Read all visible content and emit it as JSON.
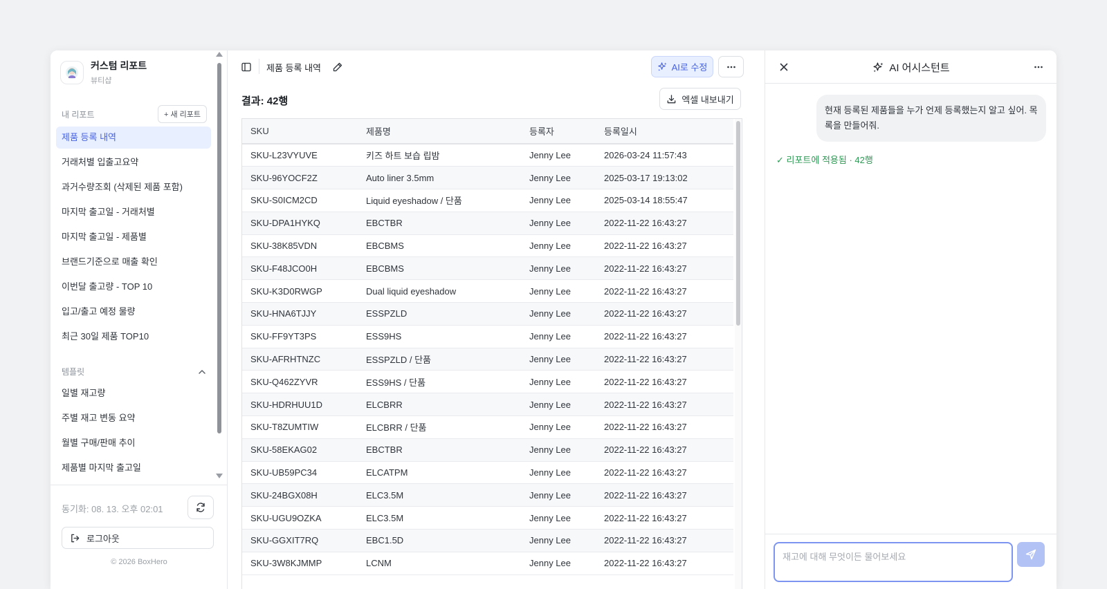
{
  "sidebar": {
    "brand_title": "커스텀 리포트",
    "brand_subtitle": "뷰티샵",
    "my_reports_label": "내 리포트",
    "new_report_label": "+ 새 리포트",
    "reports": [
      "제품 등록 내역",
      "거래처별 입출고요약",
      "과거수량조회 (삭제된 제품 포함)",
      "마지막 출고일 - 거래처별",
      "마지막 출고일 - 제품별",
      "브랜드기준으로 매출 확인",
      "이번달 출고량 - TOP 10",
      "입고/출고 예정 물량",
      "최근 30일 제품 TOP10"
    ],
    "active_report_index": 0,
    "templates_label": "템플릿",
    "templates": [
      "일별 재고량",
      "주별 재고 변동 요약",
      "월별 구매/판매 추이",
      "제품별 마지막 출고일"
    ],
    "sync_text": "동기화: 08. 13. 오후 02:01",
    "logout_label": "로그아웃",
    "copyright": "© 2026 BoxHero"
  },
  "main": {
    "report_title": "제품 등록 내역",
    "ai_edit_label": "AI로 수정",
    "result_count": "결과: 42행",
    "export_label": "엑셀 내보내기",
    "columns": [
      "SKU",
      "제품명",
      "등록자",
      "등록일시"
    ],
    "rows": [
      [
        "SKU-L23VYUVE",
        "키즈 하트 보습 립밤",
        "Jenny Lee",
        "2026-03-24 11:57:43"
      ],
      [
        "SKU-96YOCF2Z",
        "Auto liner 3.5mm",
        "Jenny Lee",
        "2025-03-17 19:13:02"
      ],
      [
        "SKU-S0ICM2CD",
        "Liquid eyeshadow / 단품",
        "Jenny Lee",
        "2025-03-14 18:55:47"
      ],
      [
        "SKU-DPA1HYKQ",
        "EBCTBR",
        "Jenny Lee",
        "2022-11-22 16:43:27"
      ],
      [
        "SKU-38K85VDN",
        "EBCBMS",
        "Jenny Lee",
        "2022-11-22 16:43:27"
      ],
      [
        "SKU-F48JCO0H",
        "EBCBMS",
        "Jenny Lee",
        "2022-11-22 16:43:27"
      ],
      [
        "SKU-K3D0RWGP",
        "Dual liquid eyeshadow",
        "Jenny Lee",
        "2022-11-22 16:43:27"
      ],
      [
        "SKU-HNA6TJJY",
        "ESSPZLD",
        "Jenny Lee",
        "2022-11-22 16:43:27"
      ],
      [
        "SKU-FF9YT3PS",
        "ESS9HS",
        "Jenny Lee",
        "2022-11-22 16:43:27"
      ],
      [
        "SKU-AFRHTNZC",
        "ESSPZLD / 단품",
        "Jenny Lee",
        "2022-11-22 16:43:27"
      ],
      [
        "SKU-Q462ZYVR",
        "ESS9HS / 단품",
        "Jenny Lee",
        "2022-11-22 16:43:27"
      ],
      [
        "SKU-HDRHUU1D",
        "ELCBRR",
        "Jenny Lee",
        "2022-11-22 16:43:27"
      ],
      [
        "SKU-T8ZUMTIW",
        "ELCBRR / 단품",
        "Jenny Lee",
        "2022-11-22 16:43:27"
      ],
      [
        "SKU-58EKAG02",
        "EBCTBR",
        "Jenny Lee",
        "2022-11-22 16:43:27"
      ],
      [
        "SKU-UB59PC34",
        "ELCATPM",
        "Jenny Lee",
        "2022-11-22 16:43:27"
      ],
      [
        "SKU-24BGX08H",
        "ELC3.5M",
        "Jenny Lee",
        "2022-11-22 16:43:27"
      ],
      [
        "SKU-UGU9OZKA",
        "ELC3.5M",
        "Jenny Lee",
        "2022-11-22 16:43:27"
      ],
      [
        "SKU-GGXIT7RQ",
        "EBC1.5D",
        "Jenny Lee",
        "2022-11-22 16:43:27"
      ],
      [
        "SKU-3W8KJMMP",
        "LCNM",
        "Jenny Lee",
        "2022-11-22 16:43:27"
      ]
    ]
  },
  "assistant": {
    "title": "AI 어시스턴트",
    "user_message": "현재 등록된 제품들을 누가 언제 등록했는지 알고 싶어. 목록을 만들어줘.",
    "applied_status": "✓ 리포트에 적용됨 · 42행",
    "input_placeholder": "재고에 대해 무엇이든 물어보세요",
    "input_value": ""
  },
  "colors": {
    "accent": "#4662e0",
    "accent_bg": "#e8efff",
    "success": "#2f9a55",
    "send_button": "#b3c2f5"
  },
  "icons": {
    "sidebar_toggle": "sidebar-toggle-icon",
    "edit": "pencil-icon",
    "ai": "sparkles-icon",
    "more": "ellipsis-icon",
    "export": "download-icon",
    "sync": "refresh-icon",
    "logout": "logout-icon",
    "close": "close-icon",
    "send": "send-icon",
    "collapse": "chevron-up-icon"
  }
}
